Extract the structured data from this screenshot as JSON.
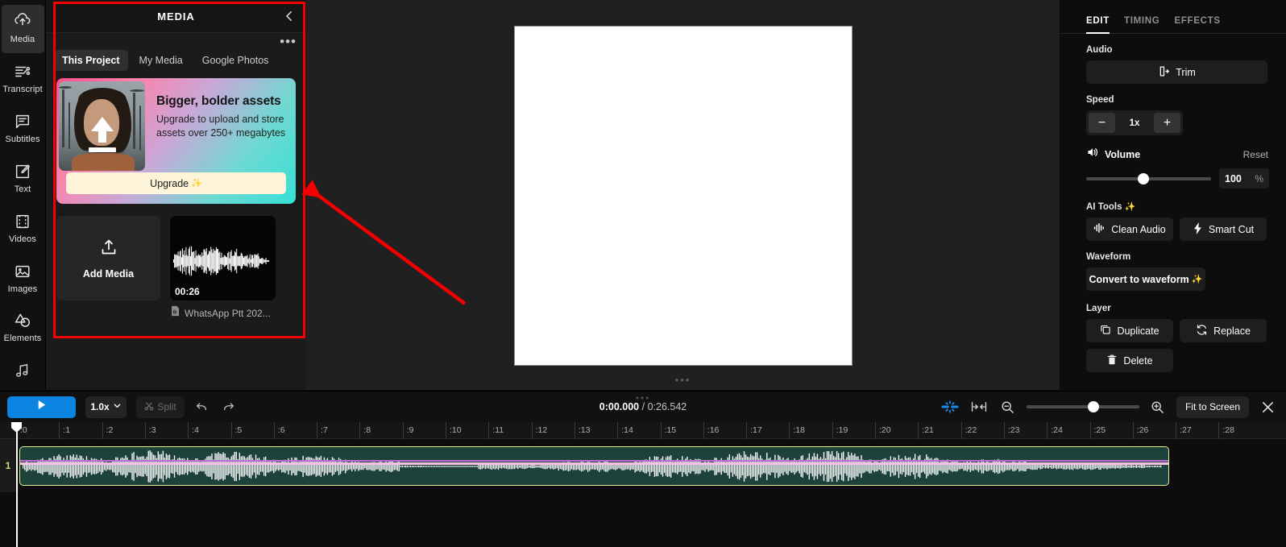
{
  "rail": {
    "items": [
      {
        "label": "Media",
        "icon": "media-upload-icon",
        "active": true
      },
      {
        "label": "Transcript",
        "icon": "transcript-icon",
        "active": false
      },
      {
        "label": "Subtitles",
        "icon": "subtitles-icon",
        "active": false
      },
      {
        "label": "Text",
        "icon": "text-edit-icon",
        "active": false
      },
      {
        "label": "Videos",
        "icon": "film-strip-icon",
        "active": false
      },
      {
        "label": "Images",
        "icon": "image-icon",
        "active": false
      },
      {
        "label": "Elements",
        "icon": "elements-shapes-icon",
        "active": false
      },
      {
        "label": "",
        "icon": "music-note-icon",
        "active": false
      }
    ]
  },
  "media_panel": {
    "title": "MEDIA",
    "collapse_icon": "chevron-left-icon",
    "more_icon": "more-horizontal-icon",
    "more_glyph": "•••",
    "tabs": [
      {
        "label": "This Project",
        "active": true
      },
      {
        "label": "My Media",
        "active": false
      },
      {
        "label": "Google Photos",
        "active": false
      }
    ],
    "promo": {
      "heading": "Bigger, bolder assets",
      "body": "Upgrade to upload and store assets over 250+ megabytes",
      "button": "Upgrade",
      "button_sparkle": "✨",
      "thumb_icon": "upload-arrow-icon"
    },
    "add_media": {
      "label": "Add Media",
      "icon": "upload-tray-icon"
    },
    "asset": {
      "duration": "00:26",
      "name": "WhatsApp Ptt 202...",
      "type_icon": "audio-file-icon"
    }
  },
  "preview": {
    "canvas_color": "#ffffff",
    "grip_icon": "drag-handle-icon",
    "grip_glyph": "•••"
  },
  "inspector": {
    "tabs": [
      {
        "label": "EDIT",
        "active": true
      },
      {
        "label": "TIMING",
        "active": false
      },
      {
        "label": "EFFECTS",
        "active": false
      }
    ],
    "audio": {
      "label": "Audio",
      "trim_button": "Trim",
      "trim_icon": "trim-icon"
    },
    "speed": {
      "label": "Speed",
      "minus": "−",
      "plus": "+",
      "value": "1x"
    },
    "volume": {
      "label": "Volume",
      "icon": "speaker-icon",
      "reset": "Reset",
      "value": "100",
      "unit": "%",
      "percent": 42
    },
    "ai_tools": {
      "label": "AI Tools",
      "sparkle": "✨",
      "clean_audio": "Clean Audio",
      "clean_audio_icon": "audio-levels-icon",
      "smart_cut": "Smart Cut",
      "smart_cut_icon": "lightning-bolt-icon"
    },
    "waveform": {
      "label": "Waveform",
      "convert_button": "Convert to waveform",
      "sparkle": "✨"
    },
    "layer": {
      "label": "Layer",
      "duplicate": "Duplicate",
      "duplicate_icon": "copy-icon",
      "replace": "Replace",
      "replace_icon": "refresh-icon",
      "delete": "Delete",
      "delete_icon": "trash-icon"
    }
  },
  "toolbar": {
    "play_icon": "play-icon",
    "rate": "1.0x",
    "rate_caret": "chevron-down-icon",
    "split": "Split",
    "split_icon": "scissors-icon",
    "undo_icon": "undo-icon",
    "redo_icon": "redo-icon",
    "current_time": "0:00.000",
    "separator": "/",
    "total_time": "0:26.542",
    "marker_icon": "add-marker-icon",
    "fit_selection_icon": "fit-selection-icon",
    "zoom_out_icon": "zoom-out-icon",
    "zoom_in_icon": "zoom-in-icon",
    "zoom_percent": 54,
    "fit_to_screen": "Fit to Screen",
    "close_icon": "close-icon"
  },
  "timeline": {
    "ticks": [
      ":0",
      ":1",
      ":2",
      ":3",
      ":4",
      ":5",
      ":6",
      ":7",
      ":8",
      ":9",
      ":10",
      ":11",
      ":12",
      ":13",
      ":14",
      ":15",
      ":16",
      ":17",
      ":18",
      ":19",
      ":20",
      ":21",
      ":22",
      ":23",
      ":24",
      ":25",
      ":26",
      ":27",
      ":28"
    ],
    "track_number": "1",
    "clip": {
      "selected": true,
      "background_color": "#1d423c",
      "border_color": "#e8ef8a",
      "waveform_color": "#ffffff"
    },
    "playhead_time": "0:00.000"
  },
  "annotation": {
    "color": "#f50000",
    "box_target": "media-panel",
    "arrow": "points-to-media-panel"
  }
}
